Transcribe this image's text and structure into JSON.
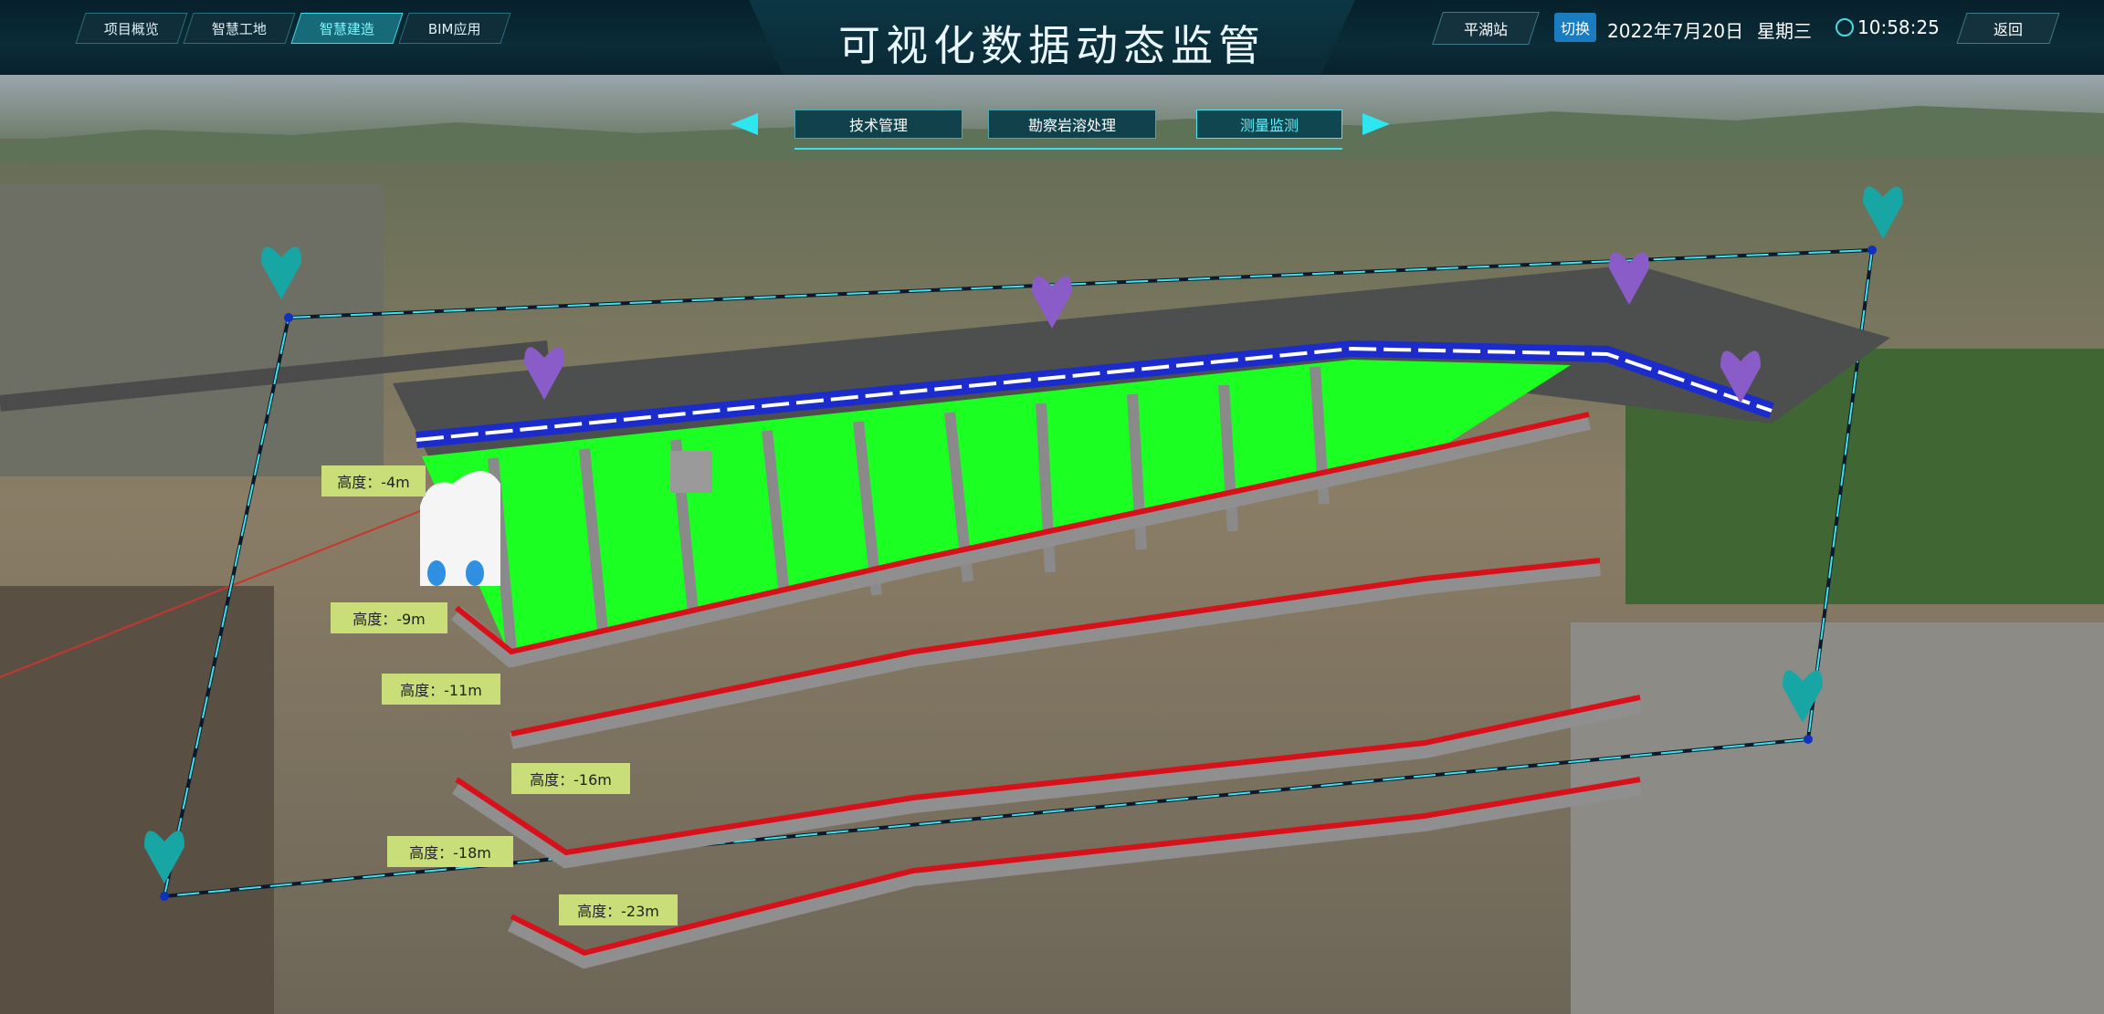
{
  "header": {
    "title": "可视化数据动态监管",
    "nav": [
      {
        "label": "项目概览"
      },
      {
        "label": "智慧工地"
      },
      {
        "label": "智慧建造",
        "active": true
      },
      {
        "label": "BIM应用"
      }
    ],
    "station": "平湖站",
    "switch_label": "切换",
    "date": "2022年7月20日",
    "weekday": "星期三",
    "time": "10:58:25",
    "back_label": "返回"
  },
  "tabs": [
    {
      "label": "技术管理"
    },
    {
      "label": "勘察岩溶处理"
    },
    {
      "label": "测量监测",
      "active": true
    }
  ],
  "height_labels": [
    "高度：-4m",
    "高度：-9m",
    "高度：-11m",
    "高度：-16m",
    "高度：-18m",
    "高度：-23m"
  ],
  "colors": {
    "accent": "#3ce4f0",
    "wall": "#1cff22",
    "contour": "#d8101a",
    "marker_teal": "#17a6a4",
    "marker_purple": "#8a5cc8",
    "label_bg": "#c9dd78"
  },
  "icons": {
    "survey_marker": "map-pin-icon",
    "clock": "clock-icon",
    "prev": "chevron-left-icon",
    "next": "chevron-right-icon"
  }
}
